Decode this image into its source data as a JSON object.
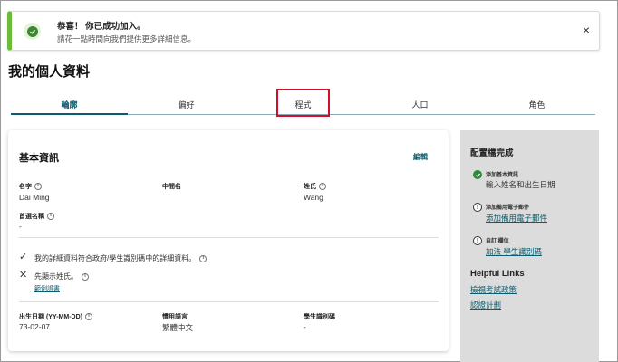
{
  "toast": {
    "title": "恭喜！ 你已成功加入。",
    "subtitle": "請花一點時間向我們提供更多詳細信息。",
    "close": "×"
  },
  "page_title": "我的個人資料",
  "tabs": [
    {
      "label": "輪廓",
      "active": true
    },
    {
      "label": "偏好",
      "active": false
    },
    {
      "label": "程式",
      "active": false
    },
    {
      "label": "人口",
      "active": false
    },
    {
      "label": "角色",
      "active": false
    }
  ],
  "basic_info": {
    "heading": "基本資訊",
    "edit_label": "編輯",
    "first_name_label": "名字",
    "first_name_value": "Dai Ming",
    "middle_name_label": "中間名",
    "last_name_label": "姓氏",
    "last_name_value": "Wang",
    "preferred_name_label": "首選名稱",
    "preferred_name_value": "-",
    "check_row_text": "我的詳細資料符合政府/學生識別碼中的詳細資料。",
    "cross_row_text": "先顯示姓氏。",
    "example_link": "範例證書",
    "dob_label": "出生日期 (YY-MM-DD)",
    "dob_value": "73-02-07",
    "language_label": "慣用語言",
    "language_value": "繁體中文",
    "student_id_label": "學生識別碼",
    "student_id_value": "-"
  },
  "profile_completion": {
    "title": "配置檔完成",
    "steps": [
      {
        "small": "添加基本資訊",
        "main": "輸入姓名和出生日期",
        "status": "done"
      },
      {
        "small": "添加備用電子郵件",
        "main": "添加備用電子郵件",
        "status": "todo"
      },
      {
        "small": "自訂 欄位",
        "main": "加法 學生識別碼",
        "status": "todo"
      }
    ],
    "helpful_links_title": "Helpful Links",
    "links": [
      "檢視考試政策",
      "認證計劃"
    ]
  },
  "colors": {
    "accent": "#0a5c6e",
    "success": "#6dbb3a",
    "highlight": "#d0102b"
  }
}
